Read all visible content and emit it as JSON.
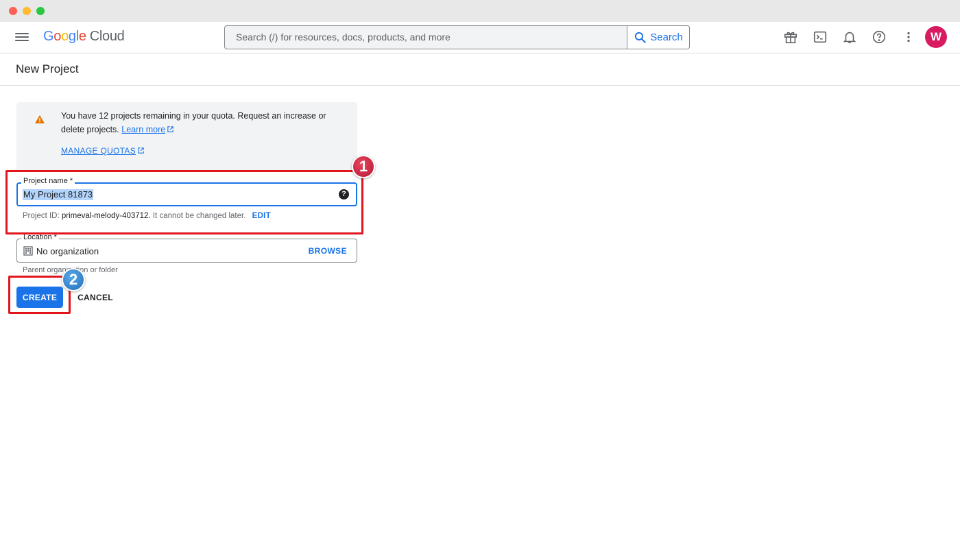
{
  "topbar": {
    "logo_google": "Google",
    "logo_cloud": "Cloud",
    "search_placeholder": "Search (/) for resources, docs, products, and more",
    "search_button": "Search",
    "icons": [
      "gift-icon",
      "cloud-shell-icon",
      "bell-icon",
      "help-icon",
      "more-vert-icon"
    ],
    "avatar_initial": "W"
  },
  "page": {
    "title": "New Project"
  },
  "quota": {
    "message": "You have 12 projects remaining in your quota. Request an increase or delete projects.",
    "learn_more": "Learn more",
    "manage_quotas": "MANAGE QUOTAS"
  },
  "form": {
    "project_name_label": "Project name",
    "required_mark": "*",
    "project_name_value": "My Project 81873",
    "project_id_prefix": "Project ID:",
    "project_id": "primeval-melody-403712.",
    "project_id_suffix": "It cannot be changed later.",
    "edit": "EDIT",
    "location_label": "Location",
    "location_value": "No organization",
    "browse": "BROWSE",
    "parent_hint": "Parent organization or folder",
    "create": "CREATE",
    "cancel": "CANCEL"
  },
  "annotations": {
    "step_1": "1",
    "step_2": "2",
    "highlight_color": "#e2141c"
  },
  "colors": {
    "accent": "#1a73e8",
    "avatar": "#d81b60",
    "warning": "#e37400"
  }
}
